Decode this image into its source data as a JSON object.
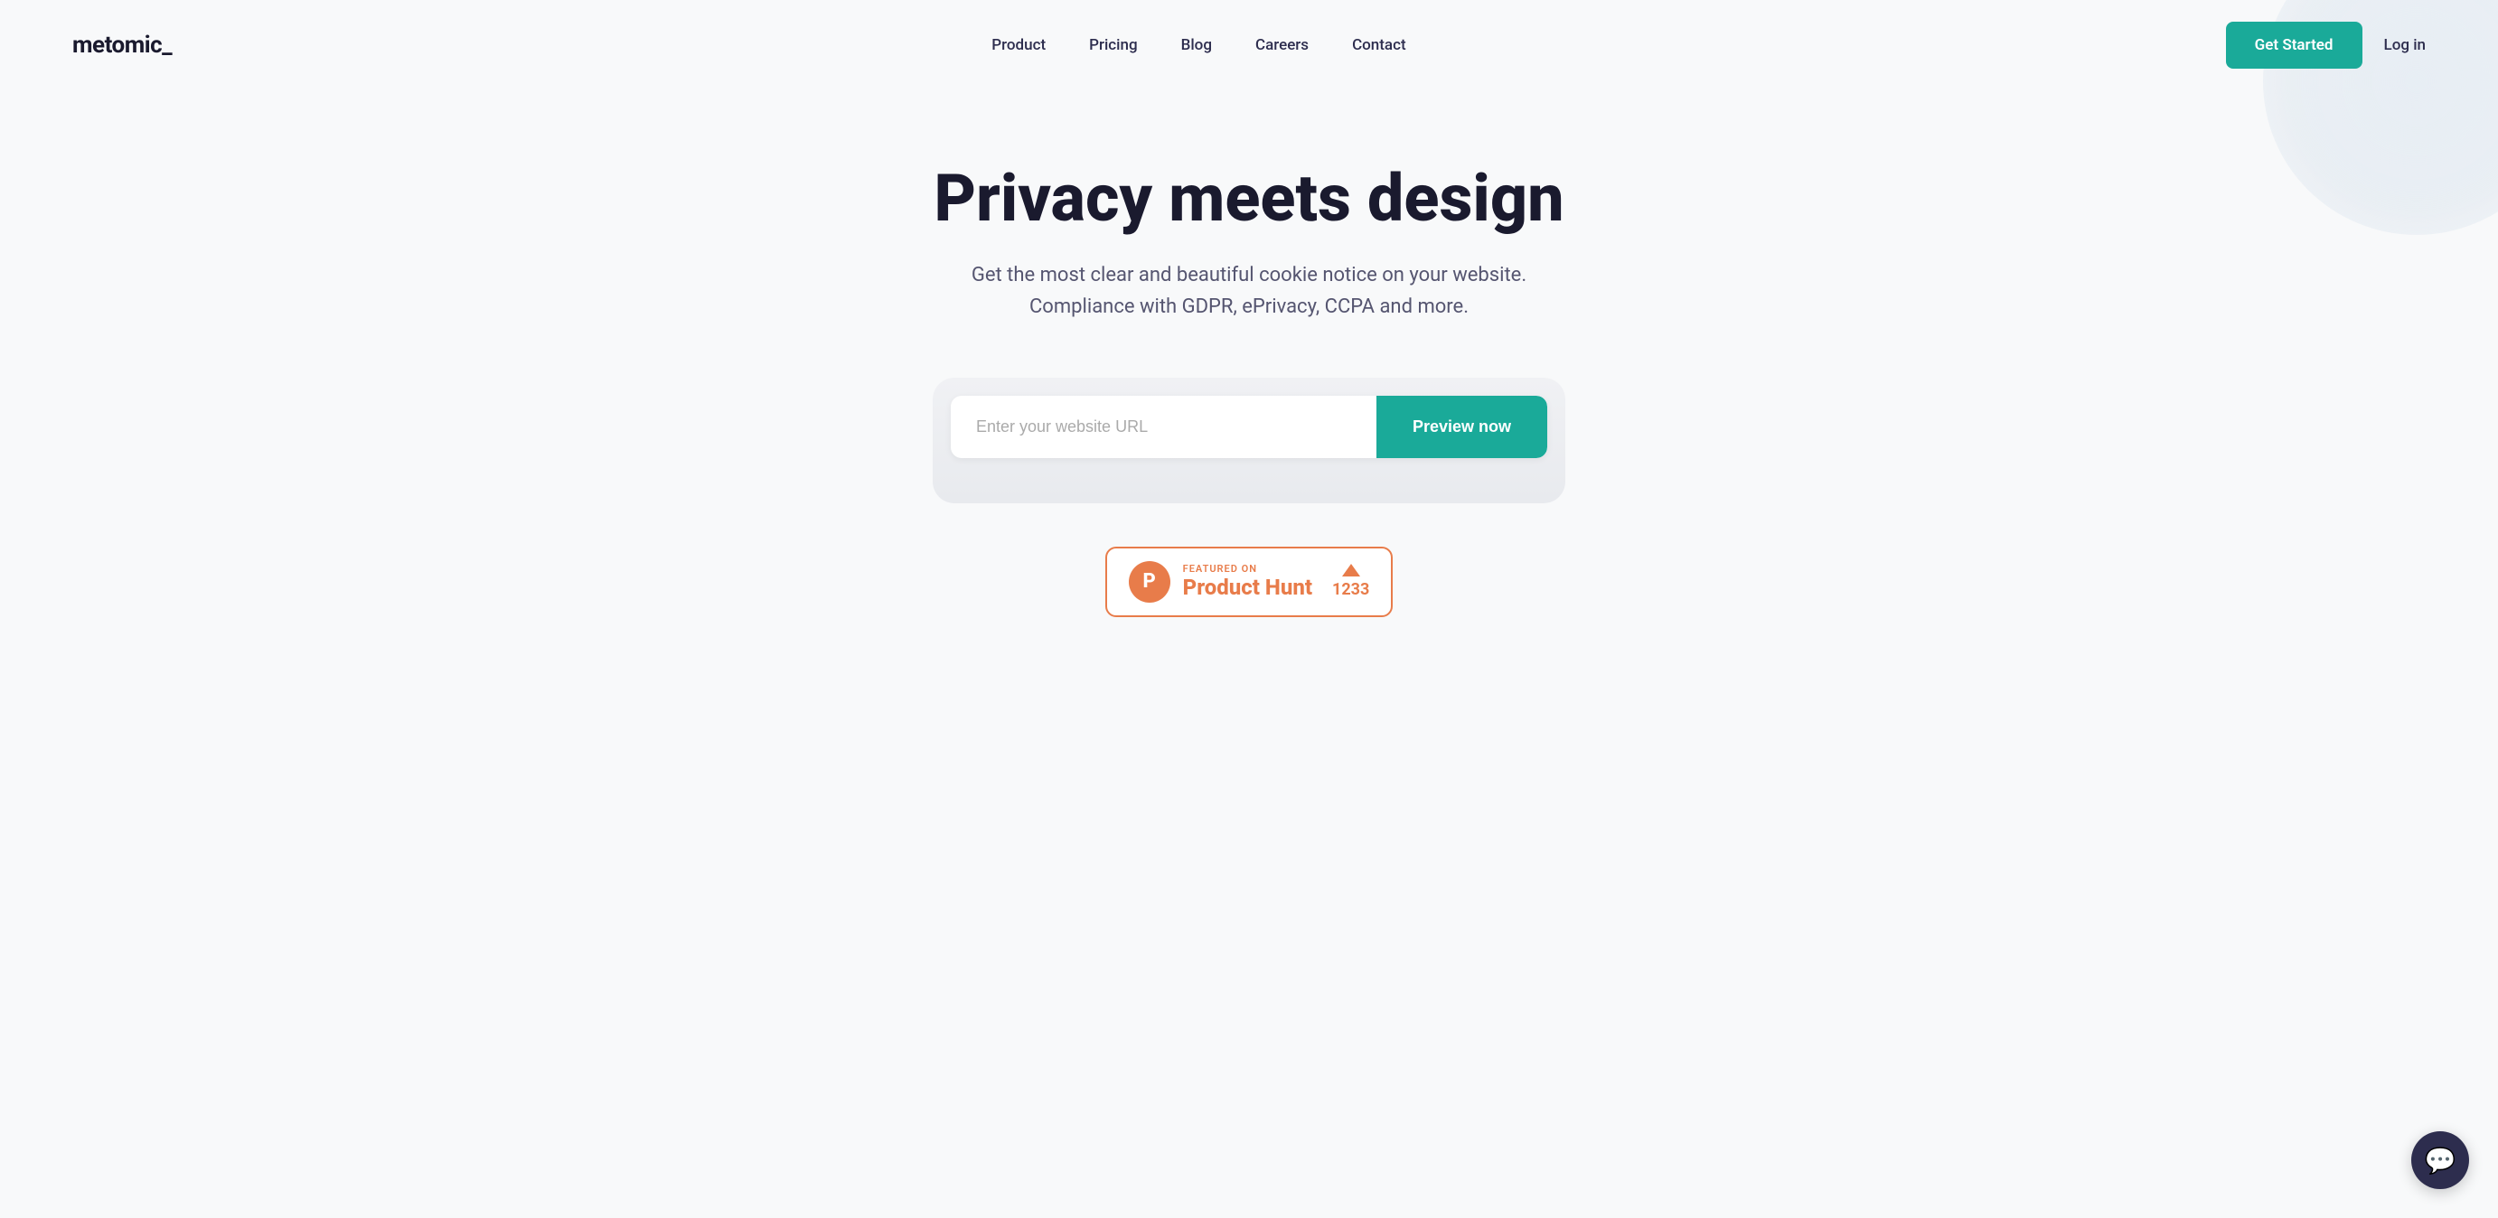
{
  "brand": {
    "logo_text": "metomic"
  },
  "nav": {
    "links": [
      {
        "label": "Product",
        "href": "#"
      },
      {
        "label": "Pricing",
        "href": "#"
      },
      {
        "label": "Blog",
        "href": "#"
      },
      {
        "label": "Careers",
        "href": "#"
      },
      {
        "label": "Contact",
        "href": "#"
      }
    ],
    "cta_label": "Get Started",
    "login_label": "Log in"
  },
  "hero": {
    "title": "Privacy meets design",
    "subtitle": "Get the most clear and beautiful cookie notice on your website. Compliance with GDPR, ePrivacy, CCPA and more."
  },
  "url_form": {
    "placeholder": "Enter your website URL",
    "button_label": "Preview now"
  },
  "product_hunt": {
    "featured_label": "FEATURED ON",
    "name": "Product Hunt",
    "icon_letter": "P",
    "vote_count": "1233"
  },
  "chat_widget": {
    "icon": "💬"
  },
  "colors": {
    "teal": "#1aaa99",
    "dark_navy": "#1a1a2e",
    "orange": "#e87c4a"
  }
}
